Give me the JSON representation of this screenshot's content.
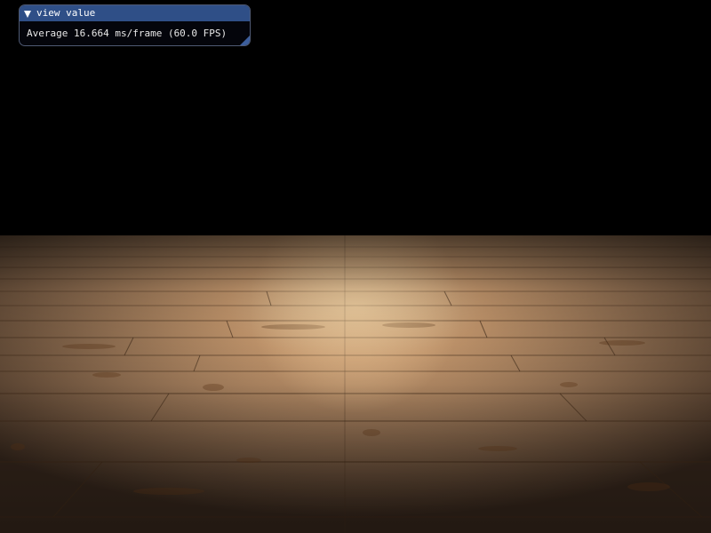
{
  "overlay": {
    "title": "view value",
    "collapse_icon": "triangle-down-icon",
    "stats_text": "Average 16.664 ms/frame (60.0 FPS)",
    "resize_icon": "resize-grip-icon"
  },
  "colors": {
    "title_bar": "#2f4f87",
    "window_bg": "#04060c",
    "window_border": "#4f5a74",
    "text": "#e8e8e8",
    "scene_background": "#000000",
    "wood_light": "#d8aa78",
    "wood_dark": "#6a4a30"
  }
}
